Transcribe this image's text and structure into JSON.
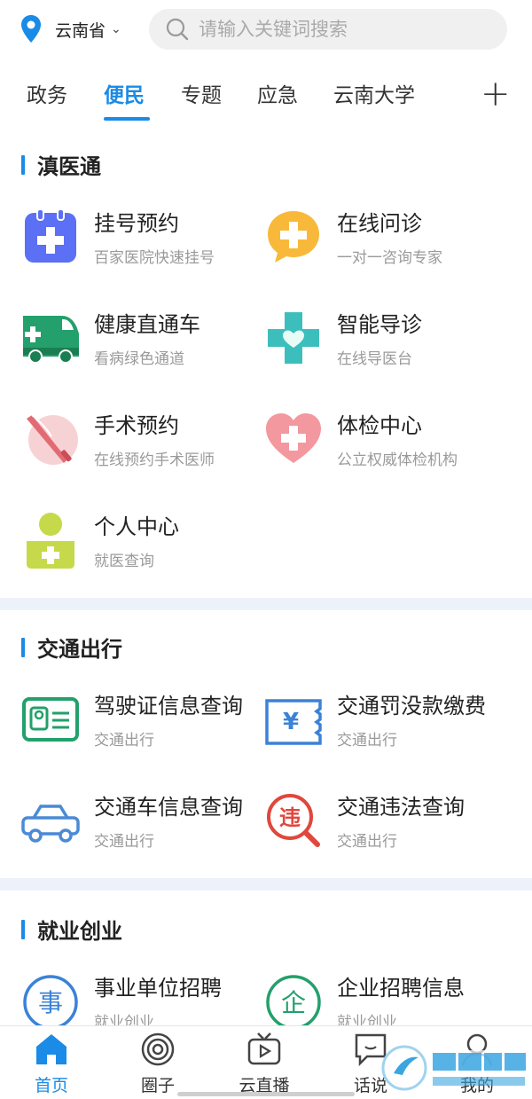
{
  "header": {
    "location": "云南省",
    "search_placeholder": "请输入关键词搜索"
  },
  "tabs": [
    {
      "label": "政务",
      "active": false
    },
    {
      "label": "便民",
      "active": true
    },
    {
      "label": "专题",
      "active": false
    },
    {
      "label": "应急",
      "active": false
    },
    {
      "label": "云南大学",
      "active": false
    }
  ],
  "sections": {
    "medical": {
      "title": "滇医通",
      "items": [
        {
          "title": "挂号预约",
          "sub": "百家医院快速挂号"
        },
        {
          "title": "在线问诊",
          "sub": "一对一咨询专家"
        },
        {
          "title": "健康直通车",
          "sub": "看病绿色通道"
        },
        {
          "title": "智能导诊",
          "sub": "在线导医台"
        },
        {
          "title": "手术预约",
          "sub": "在线预约手术医师"
        },
        {
          "title": "体检中心",
          "sub": "公立权威体检机构"
        },
        {
          "title": "个人中心",
          "sub": "就医查询"
        }
      ]
    },
    "traffic": {
      "title": "交通出行",
      "items": [
        {
          "title": "驾驶证信息查询",
          "sub": "交通出行"
        },
        {
          "title": "交通罚没款缴费",
          "sub": "交通出行"
        },
        {
          "title": "交通车信息查询",
          "sub": "交通出行"
        },
        {
          "title": "交通违法查询",
          "sub": "交通出行"
        }
      ]
    },
    "jobs": {
      "title": "就业创业",
      "items": [
        {
          "title": "事业单位招聘",
          "sub": "就业创业",
          "glyph": "事"
        },
        {
          "title": "企业招聘信息",
          "sub": "就业创业",
          "glyph": "企"
        }
      ]
    }
  },
  "bottom_nav": [
    {
      "label": "首页",
      "active": true
    },
    {
      "label": "圈子",
      "active": false
    },
    {
      "label": "云直播",
      "active": false
    },
    {
      "label": "话说",
      "active": false
    },
    {
      "label": "我的",
      "active": false
    }
  ],
  "icon_glyphs": {
    "fine": "¥",
    "violation": "违"
  },
  "colors": {
    "accent": "#1a8be6",
    "divider": "#edf2fa"
  }
}
